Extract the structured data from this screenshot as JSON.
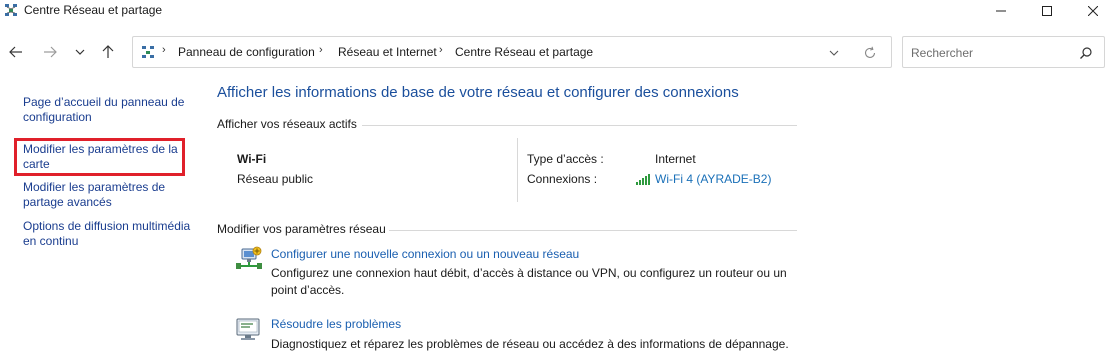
{
  "window": {
    "title": "Centre Réseau et partage",
    "controls": [
      "minimize-icon",
      "maximize-icon",
      "close-icon"
    ]
  },
  "navbar": {
    "breadcrumb": [
      "Panneau de configuration",
      "Réseau et Internet",
      "Centre Réseau et partage"
    ],
    "search_placeholder": "Rechercher"
  },
  "sidebar": {
    "items": [
      {
        "label": "Page d’accueil du panneau de configuration"
      },
      {
        "label": "Modifier les paramètres de la carte",
        "highlighted": true
      },
      {
        "label": "Modifier les paramètres de partage avancés"
      },
      {
        "label": "Options de diffusion multimédia en continu"
      }
    ],
    "highlight_color": "#e0202a"
  },
  "main": {
    "title": "Afficher les informations de base de votre réseau et configurer des connexions",
    "active_networks_heading": "Afficher vos réseaux actifs",
    "network": {
      "name": "Wi-Fi",
      "type": "Réseau public",
      "access_type_label": "Type d’accès :",
      "access_type_value": "Internet",
      "connections_label": "Connexions :",
      "connection_link": "Wi-Fi 4 (AYRADE-B2)"
    },
    "modify_heading": "Modifier vos paramètres réseau",
    "tasks": [
      {
        "icon": "new-connection-icon",
        "link": "Configurer une nouvelle connexion ou un nouveau réseau",
        "description": "Configurez une connexion haut débit, d’accès à distance ou VPN, ou configurez un routeur ou un point d’accès."
      },
      {
        "icon": "troubleshoot-icon",
        "link": "Résoudre les problèmes",
        "description": "Diagnostiquez et réparez les problèmes de réseau ou accédez à des informations de dépannage."
      }
    ]
  },
  "colors": {
    "title_blue": "#1b4f9c",
    "link_blue": "#1a5fb0",
    "wifi_green": "#2e9a3e"
  }
}
